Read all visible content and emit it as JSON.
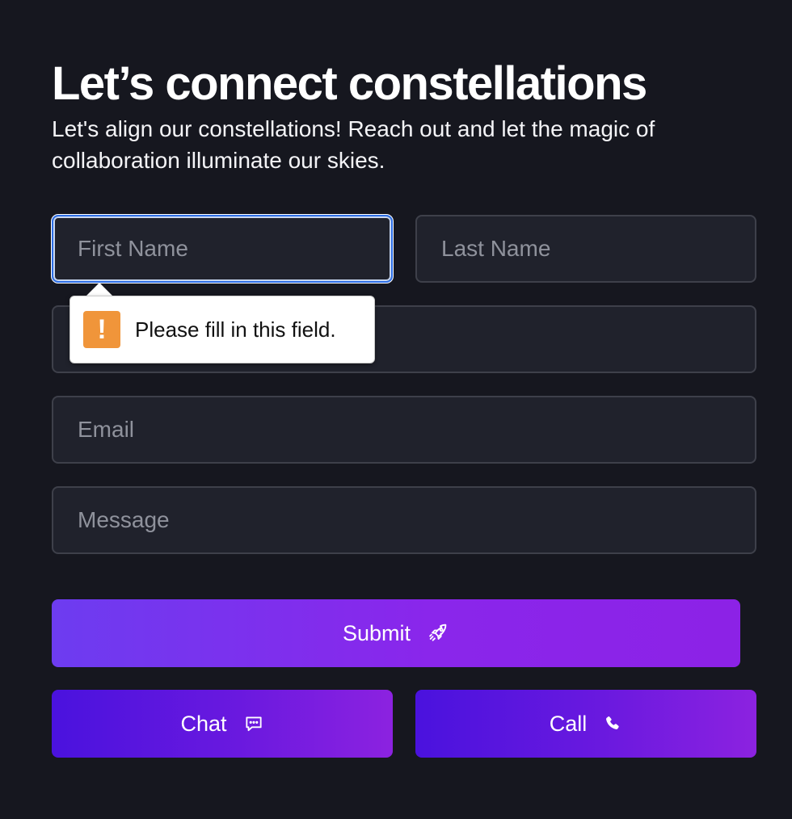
{
  "header": {
    "title": "Let’s connect constellations",
    "subtitle": "Let's align our constellations! Reach out and let the magic of collaboration illuminate our skies."
  },
  "form": {
    "first_name_placeholder": "First Name",
    "last_name_placeholder": "Last Name",
    "phone_placeholder": "",
    "email_placeholder": "Email",
    "message_placeholder": "Message"
  },
  "validation": {
    "message": "Please fill in this field.",
    "icon": "warning-icon",
    "icon_symbol": "!",
    "color": "#f0953a"
  },
  "buttons": {
    "submit_label": "Submit",
    "submit_icon": "rocket-icon",
    "chat_label": "Chat",
    "chat_icon": "chat-bubble-icon",
    "call_label": "Call",
    "call_icon": "phone-icon"
  },
  "colors": {
    "background": "#16171f",
    "field_background": "#20222c",
    "focus_border": "#2c6ee6",
    "accent_start": "#6d3cf0",
    "accent_end": "#8c22e6"
  }
}
